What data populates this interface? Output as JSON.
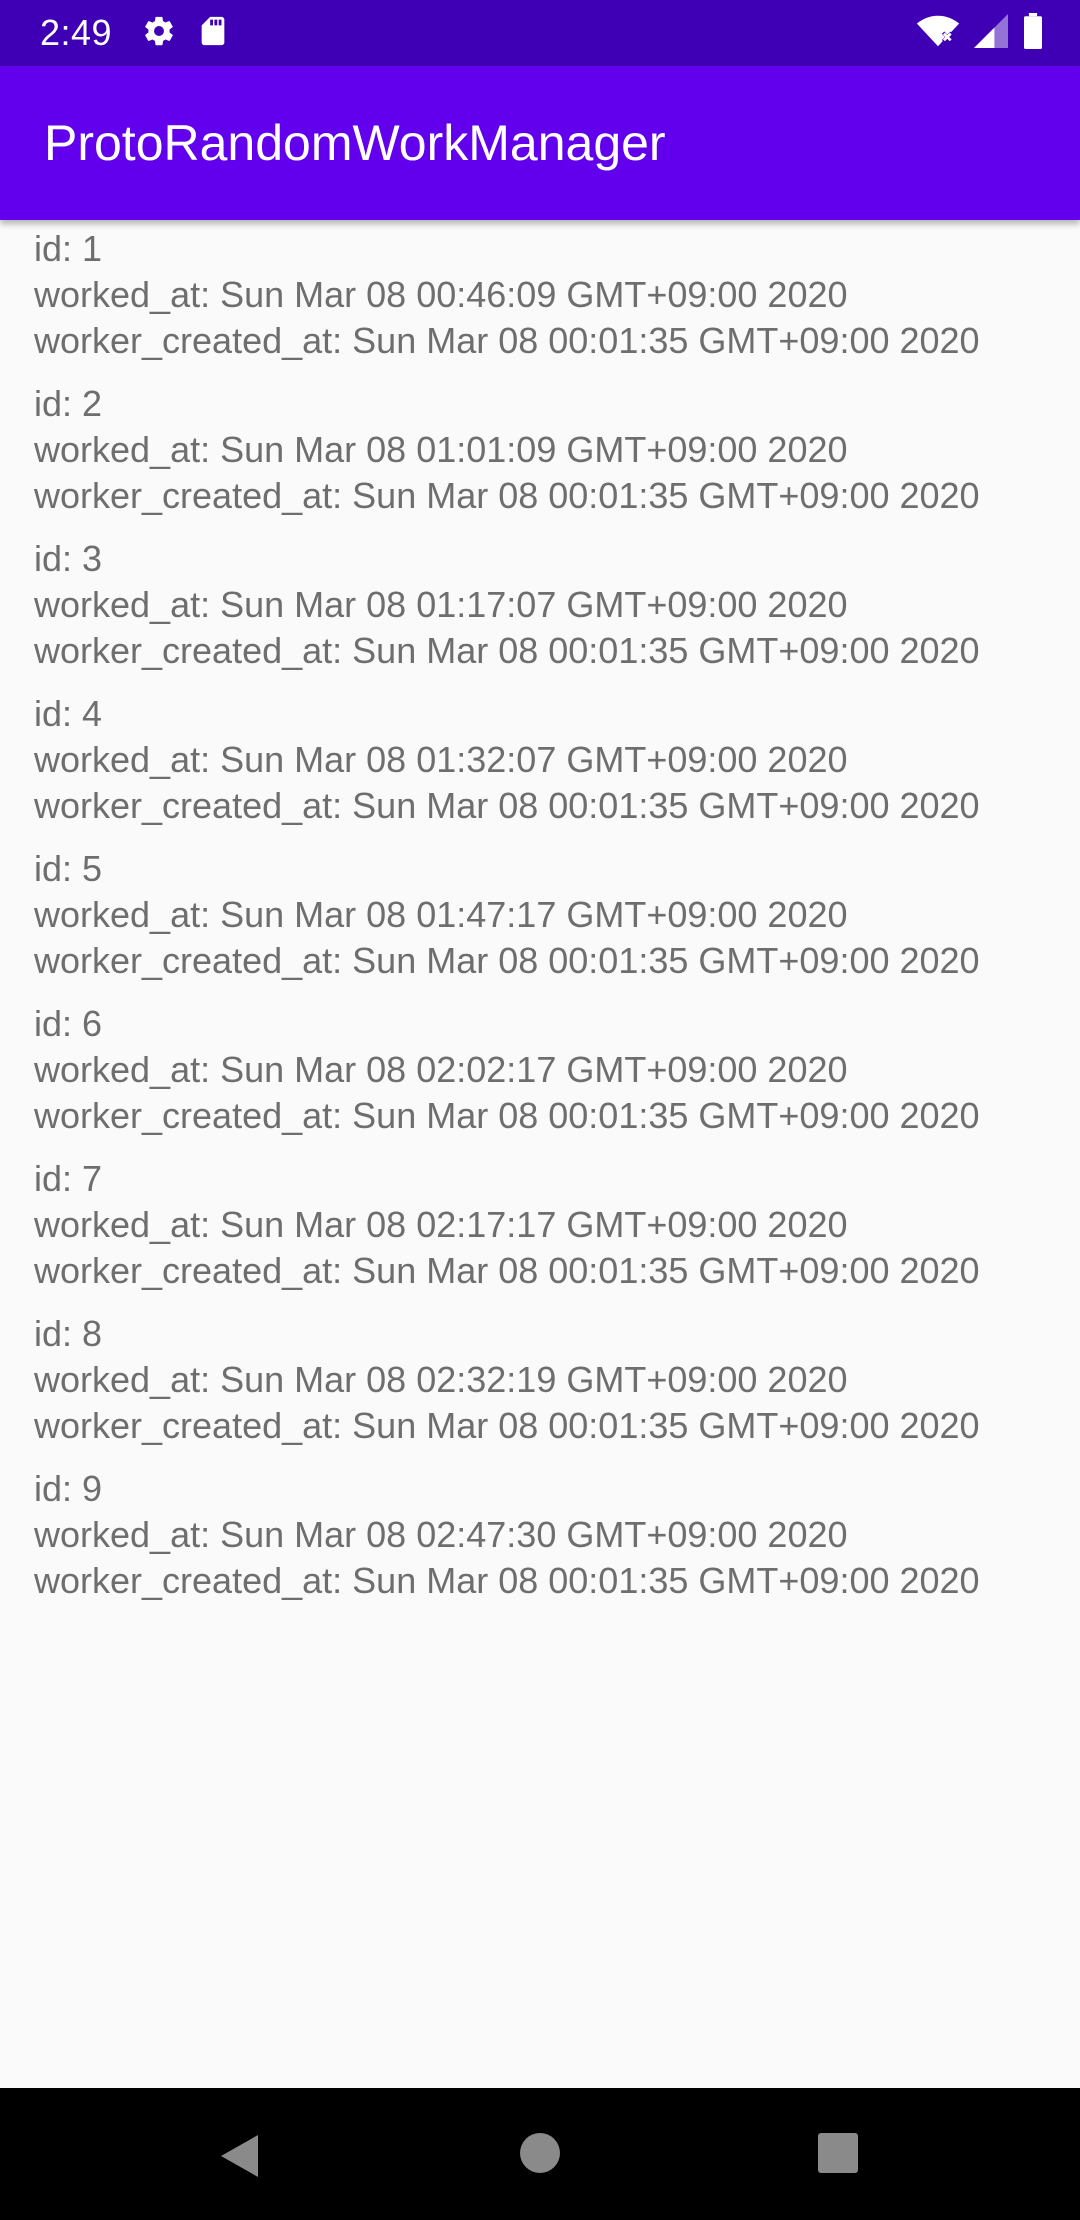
{
  "status_bar": {
    "time": "2:49",
    "left_icons": [
      "gear-icon",
      "sd-card-icon"
    ],
    "right_icons": [
      "wifi-off-icon",
      "signal-icon",
      "battery-icon"
    ],
    "background": "#3f00b5"
  },
  "app_bar": {
    "title": "ProtoRandomWorkManager",
    "background": "#6200ee"
  },
  "records": [
    {
      "id": "id: 1",
      "worked_at": "worked_at: Sun Mar 08 00:46:09 GMT+09:00 2020",
      "worker_created_at": "worker_created_at: Sun Mar 08 00:01:35 GMT+09:00 2020"
    },
    {
      "id": "id: 2",
      "worked_at": "worked_at: Sun Mar 08 01:01:09 GMT+09:00 2020",
      "worker_created_at": "worker_created_at: Sun Mar 08 00:01:35 GMT+09:00 2020"
    },
    {
      "id": "id: 3",
      "worked_at": "worked_at: Sun Mar 08 01:17:07 GMT+09:00 2020",
      "worker_created_at": "worker_created_at: Sun Mar 08 00:01:35 GMT+09:00 2020"
    },
    {
      "id": "id: 4",
      "worked_at": "worked_at: Sun Mar 08 01:32:07 GMT+09:00 2020",
      "worker_created_at": "worker_created_at: Sun Mar 08 00:01:35 GMT+09:00 2020"
    },
    {
      "id": "id: 5",
      "worked_at": "worked_at: Sun Mar 08 01:47:17 GMT+09:00 2020",
      "worker_created_at": "worker_created_at: Sun Mar 08 00:01:35 GMT+09:00 2020"
    },
    {
      "id": "id: 6",
      "worked_at": "worked_at: Sun Mar 08 02:02:17 GMT+09:00 2020",
      "worker_created_at": "worker_created_at: Sun Mar 08 00:01:35 GMT+09:00 2020"
    },
    {
      "id": "id: 7",
      "worked_at": "worked_at: Sun Mar 08 02:17:17 GMT+09:00 2020",
      "worker_created_at": "worker_created_at: Sun Mar 08 00:01:35 GMT+09:00 2020"
    },
    {
      "id": "id: 8",
      "worked_at": "worked_at: Sun Mar 08 02:32:19 GMT+09:00 2020",
      "worker_created_at": "worker_created_at: Sun Mar 08 00:01:35 GMT+09:00 2020"
    },
    {
      "id": "id: 9",
      "worked_at": "worked_at: Sun Mar 08 02:47:30 GMT+09:00 2020",
      "worker_created_at": "worker_created_at: Sun Mar 08 00:01:35 GMT+09:00 2020"
    }
  ],
  "nav_bar": {
    "buttons": [
      "back-icon",
      "home-icon",
      "recents-icon"
    ]
  }
}
